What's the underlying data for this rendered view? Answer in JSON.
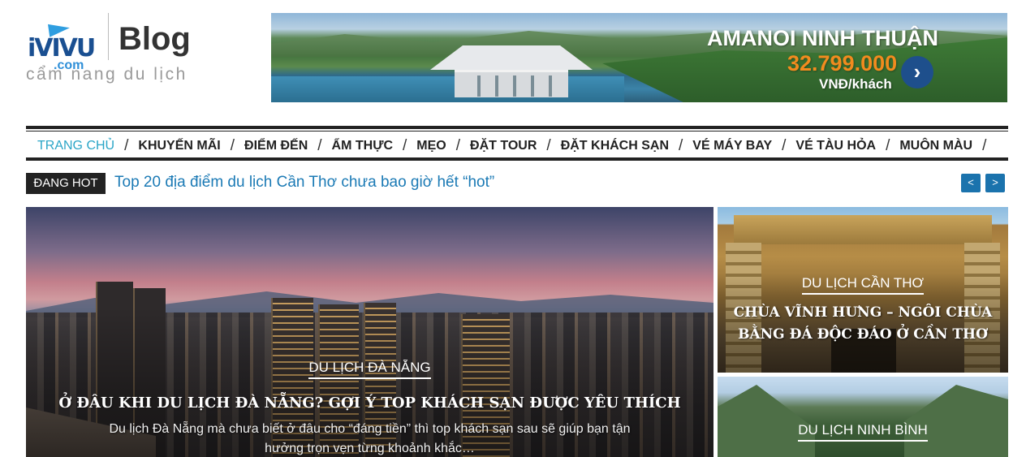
{
  "logo": {
    "brand_main": "iVIVU",
    "brand_sub": ".com",
    "blog_label": "Blog",
    "tagline": "cẩm nang du lịch"
  },
  "banner": {
    "title": "AMANOI NINH THUẬN",
    "price": "32.799.000",
    "unit": "VNĐ/khách",
    "arrow_icon": "chevron-right-icon"
  },
  "nav": {
    "items": [
      {
        "label": "TRANG CHỦ",
        "active": true
      },
      {
        "label": "KHUYẾN MÃI"
      },
      {
        "label": "ĐIỂM ĐẾN"
      },
      {
        "label": "ẨM THỰC"
      },
      {
        "label": "MẸO"
      },
      {
        "label": "ĐẶT TOUR"
      },
      {
        "label": "ĐẶT KHÁCH SẠN"
      },
      {
        "label": "VÉ MÁY BAY"
      },
      {
        "label": "VÉ TÀU HỎA"
      },
      {
        "label": "MUÔN MÀU"
      }
    ],
    "separator": "/"
  },
  "hot": {
    "badge": "ĐANG HOT",
    "headline": "Top 20 địa điểm du lịch Cần Thơ chưa bao giờ hết “hot”",
    "prev_label": "<",
    "next_label": ">"
  },
  "featured": {
    "main": {
      "category": "DU LỊCH ĐÀ NẴNG",
      "title": "Ở ĐÂU KHI DU LỊCH ĐÀ NẴNG? GỢI Ý TOP KHÁCH SẠN ĐƯỢC YÊU THÍCH",
      "excerpt": "Du lịch Đà Nẵng mà chưa biết ở đâu cho “đáng tiền” thì top khách sạn sau sẽ giúp bạn tận hưởng trọn vẹn từng khoảnh khắc…"
    },
    "side1": {
      "category": "DU LỊCH CẦN THƠ",
      "title": "CHÙA VĨNH HƯNG – NGÔI CHÙA BẰNG ĐÁ ĐỘC ĐÁO Ở CẦN THƠ"
    },
    "side2": {
      "category": "DU LỊCH NINH BÌNH",
      "title": ""
    }
  },
  "colors": {
    "accent": "#2aa5c7",
    "link": "#1b7ab5",
    "banner_price": "#f28b1e",
    "hot_badge_bg": "#222222",
    "ticker_button": "#1b73ad"
  }
}
